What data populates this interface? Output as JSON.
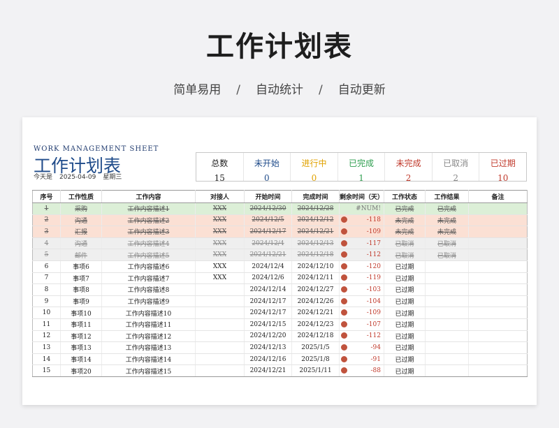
{
  "header": {
    "title": "工作计划表"
  },
  "tagline": {
    "items": [
      "简单易用",
      "自动统计",
      "自动更新"
    ],
    "separator": "/"
  },
  "sheet": {
    "english_title": "WORK MANAGEMENT SHEET",
    "title": "工作计划表",
    "today_label": "今天是",
    "date": "2025-04-09",
    "weekday": "星期三"
  },
  "stats": [
    {
      "label": "总数",
      "value": "15",
      "color": "#222222"
    },
    {
      "label": "未开始",
      "value": "0",
      "color": "#1f4b8a"
    },
    {
      "label": "进行中",
      "value": "0",
      "color": "#e0a100"
    },
    {
      "label": "已完成",
      "value": "1",
      "color": "#2e9e4f"
    },
    {
      "label": "未完成",
      "value": "2",
      "color": "#c0392b"
    },
    {
      "label": "已取消",
      "value": "2",
      "color": "#888888"
    },
    {
      "label": "已过期",
      "value": "10",
      "color": "#c0392b"
    }
  ],
  "table": {
    "columns": [
      "序号",
      "工作性质",
      "工作内容",
      "对接人",
      "开始时间",
      "完成时间",
      "剩余时间（天）",
      "工作状态",
      "工作结果",
      "备注"
    ],
    "rows": [
      {
        "no": "1",
        "type": "采购",
        "content": "工作内容描述1",
        "contact": "XXX",
        "start": "2024/12/30",
        "end": "2024/12/28",
        "remain": "#NUM!",
        "dot": false,
        "status": "已完成",
        "result": "已完成",
        "note": "",
        "kind": "done"
      },
      {
        "no": "2",
        "type": "沟通",
        "content": "工作内容描述2",
        "contact": "XXX",
        "start": "2024/12/5",
        "end": "2024/12/12",
        "remain": "-118",
        "dot": true,
        "status": "未完成",
        "result": "未完成",
        "note": "",
        "kind": "undone"
      },
      {
        "no": "3",
        "type": "汇报",
        "content": "工作内容描述3",
        "contact": "XXX",
        "start": "2024/12/17",
        "end": "2024/12/21",
        "remain": "-109",
        "dot": true,
        "status": "未完成",
        "result": "未完成",
        "note": "",
        "kind": "undone"
      },
      {
        "no": "4",
        "type": "沟通",
        "content": "工作内容描述4",
        "contact": "XXX",
        "start": "2024/12/4",
        "end": "2024/12/13",
        "remain": "-117",
        "dot": true,
        "status": "已取消",
        "result": "已取消",
        "note": "",
        "kind": "cancel"
      },
      {
        "no": "5",
        "type": "邮件",
        "content": "工作内容描述5",
        "contact": "XXX",
        "start": "2024/12/21",
        "end": "2024/12/18",
        "remain": "-112",
        "dot": true,
        "status": "已取消",
        "result": "已取消",
        "note": "",
        "kind": "cancel"
      },
      {
        "no": "6",
        "type": "事项6",
        "content": "工作内容描述6",
        "contact": "XXX",
        "start": "2024/12/4",
        "end": "2024/12/10",
        "remain": "-120",
        "dot": true,
        "status": "已过期",
        "result": "",
        "note": "",
        "kind": "expired"
      },
      {
        "no": "7",
        "type": "事项7",
        "content": "工作内容描述7",
        "contact": "XXX",
        "start": "2024/12/6",
        "end": "2024/12/11",
        "remain": "-119",
        "dot": true,
        "status": "已过期",
        "result": "",
        "note": "",
        "kind": "expired"
      },
      {
        "no": "8",
        "type": "事项8",
        "content": "工作内容描述8",
        "contact": "",
        "start": "2024/12/14",
        "end": "2024/12/27",
        "remain": "-103",
        "dot": true,
        "status": "已过期",
        "result": "",
        "note": "",
        "kind": "expired"
      },
      {
        "no": "9",
        "type": "事项9",
        "content": "工作内容描述9",
        "contact": "",
        "start": "2024/12/17",
        "end": "2024/12/26",
        "remain": "-104",
        "dot": true,
        "status": "已过期",
        "result": "",
        "note": "",
        "kind": "expired"
      },
      {
        "no": "10",
        "type": "事项10",
        "content": "工作内容描述10",
        "contact": "",
        "start": "2024/12/17",
        "end": "2024/12/21",
        "remain": "-109",
        "dot": true,
        "status": "已过期",
        "result": "",
        "note": "",
        "kind": "expired"
      },
      {
        "no": "11",
        "type": "事项11",
        "content": "工作内容描述11",
        "contact": "",
        "start": "2024/12/15",
        "end": "2024/12/23",
        "remain": "-107",
        "dot": true,
        "status": "已过期",
        "result": "",
        "note": "",
        "kind": "expired"
      },
      {
        "no": "12",
        "type": "事项12",
        "content": "工作内容描述12",
        "contact": "",
        "start": "2024/12/20",
        "end": "2024/12/18",
        "remain": "-112",
        "dot": true,
        "status": "已过期",
        "result": "",
        "note": "",
        "kind": "expired"
      },
      {
        "no": "13",
        "type": "事项13",
        "content": "工作内容描述13",
        "contact": "",
        "start": "2024/12/13",
        "end": "2025/1/5",
        "remain": "-94",
        "dot": true,
        "status": "已过期",
        "result": "",
        "note": "",
        "kind": "expired"
      },
      {
        "no": "14",
        "type": "事项14",
        "content": "工作内容描述14",
        "contact": "",
        "start": "2024/12/16",
        "end": "2025/1/8",
        "remain": "-91",
        "dot": true,
        "status": "已过期",
        "result": "",
        "note": "",
        "kind": "expired"
      },
      {
        "no": "15",
        "type": "事项20",
        "content": "工作内容描述15",
        "contact": "",
        "start": "2024/12/21",
        "end": "2025/1/11",
        "remain": "-88",
        "dot": true,
        "status": "已过期",
        "result": "",
        "note": "",
        "kind": "expired"
      }
    ]
  }
}
